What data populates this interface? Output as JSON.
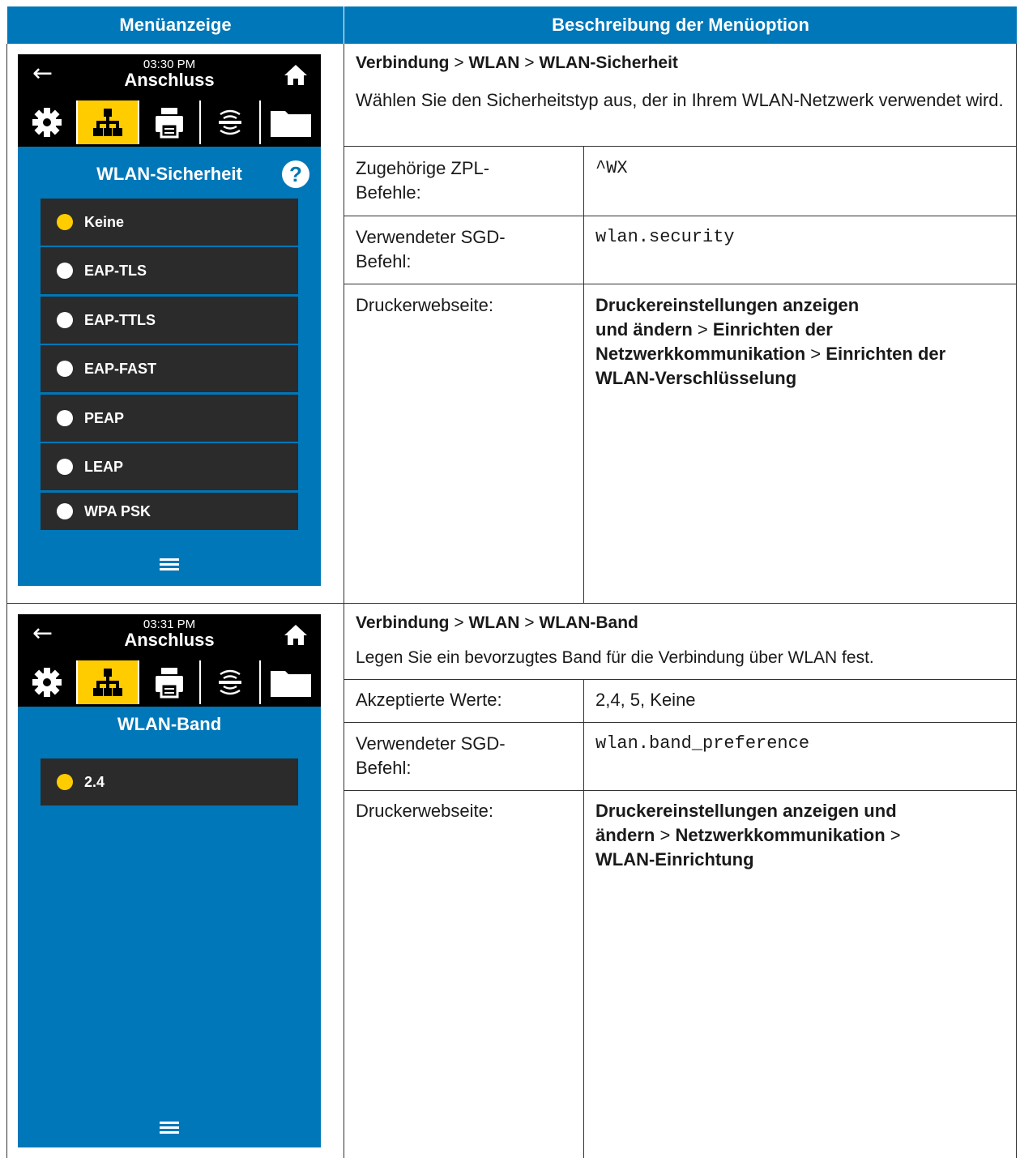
{
  "header": {
    "left": "Menüanzeige",
    "right": "Beschreibung der Menüoption"
  },
  "colors": {
    "blue": "#0077b8",
    "yellow": "#ffcc00",
    "dark": "#2b2b2b"
  },
  "row1": {
    "screen": {
      "time": "03:30 PM",
      "title": "Anschluss",
      "heading": "WLAN-Sicherheit",
      "help": "?",
      "options": [
        "Keine",
        "EAP-TLS",
        "EAP-TTLS",
        "EAP-FAST",
        "PEAP",
        "LEAP",
        "WPA PSK"
      ],
      "selected": "Keine"
    },
    "path": {
      "p1": "Verbindung",
      "sep": ">",
      "p2": "WLAN",
      "p3": "WLAN-Sicherheit"
    },
    "description": "Wählen Sie den Sicherheitstyp aus, der in Ihrem WLAN-Netzwerk verwendet wird.",
    "table": [
      {
        "label_1": "Zugehörige ZPL-",
        "label_2": "Befehle:",
        "value": "^WX"
      },
      {
        "label_1": "Verwendeter SGD-",
        "label_2": "Befehl:",
        "value": "wlan.security"
      },
      {
        "label_1": "Druckerwebseite:",
        "web_a": "Druckereinstellungen anzeigen",
        "web_b": "und ändern",
        "web_c": "Einrichten der",
        "web_d": "Netzwerkkommunikation",
        "web_e": "Einrichten der",
        "web_f": "WLAN-Verschlüsselung"
      }
    ]
  },
  "row2": {
    "screen": {
      "time": "03:31 PM",
      "title": "Anschluss",
      "heading": "WLAN-Band",
      "options": [
        "2.4"
      ],
      "selected": "2.4"
    },
    "path": {
      "p1": "Verbindung",
      "sep": ">",
      "p2": "WLAN",
      "p3": "WLAN-Band"
    },
    "description": "Legen Sie ein bevorzugtes Band für die Verbindung über WLAN fest.",
    "table": [
      {
        "label": "Akzeptierte Werte:",
        "value": "2,4, 5, Keine"
      },
      {
        "label_1": "Verwendeter SGD-",
        "label_2": "Befehl:",
        "value": "wlan.band_preference"
      },
      {
        "label": "Druckerwebseite:",
        "web_a": "Druckereinstellungen anzeigen und",
        "web_b": "ändern",
        "web_c": "Netzwerkkommunikation",
        "web_d": "WLAN-Einrichtung"
      }
    ]
  }
}
